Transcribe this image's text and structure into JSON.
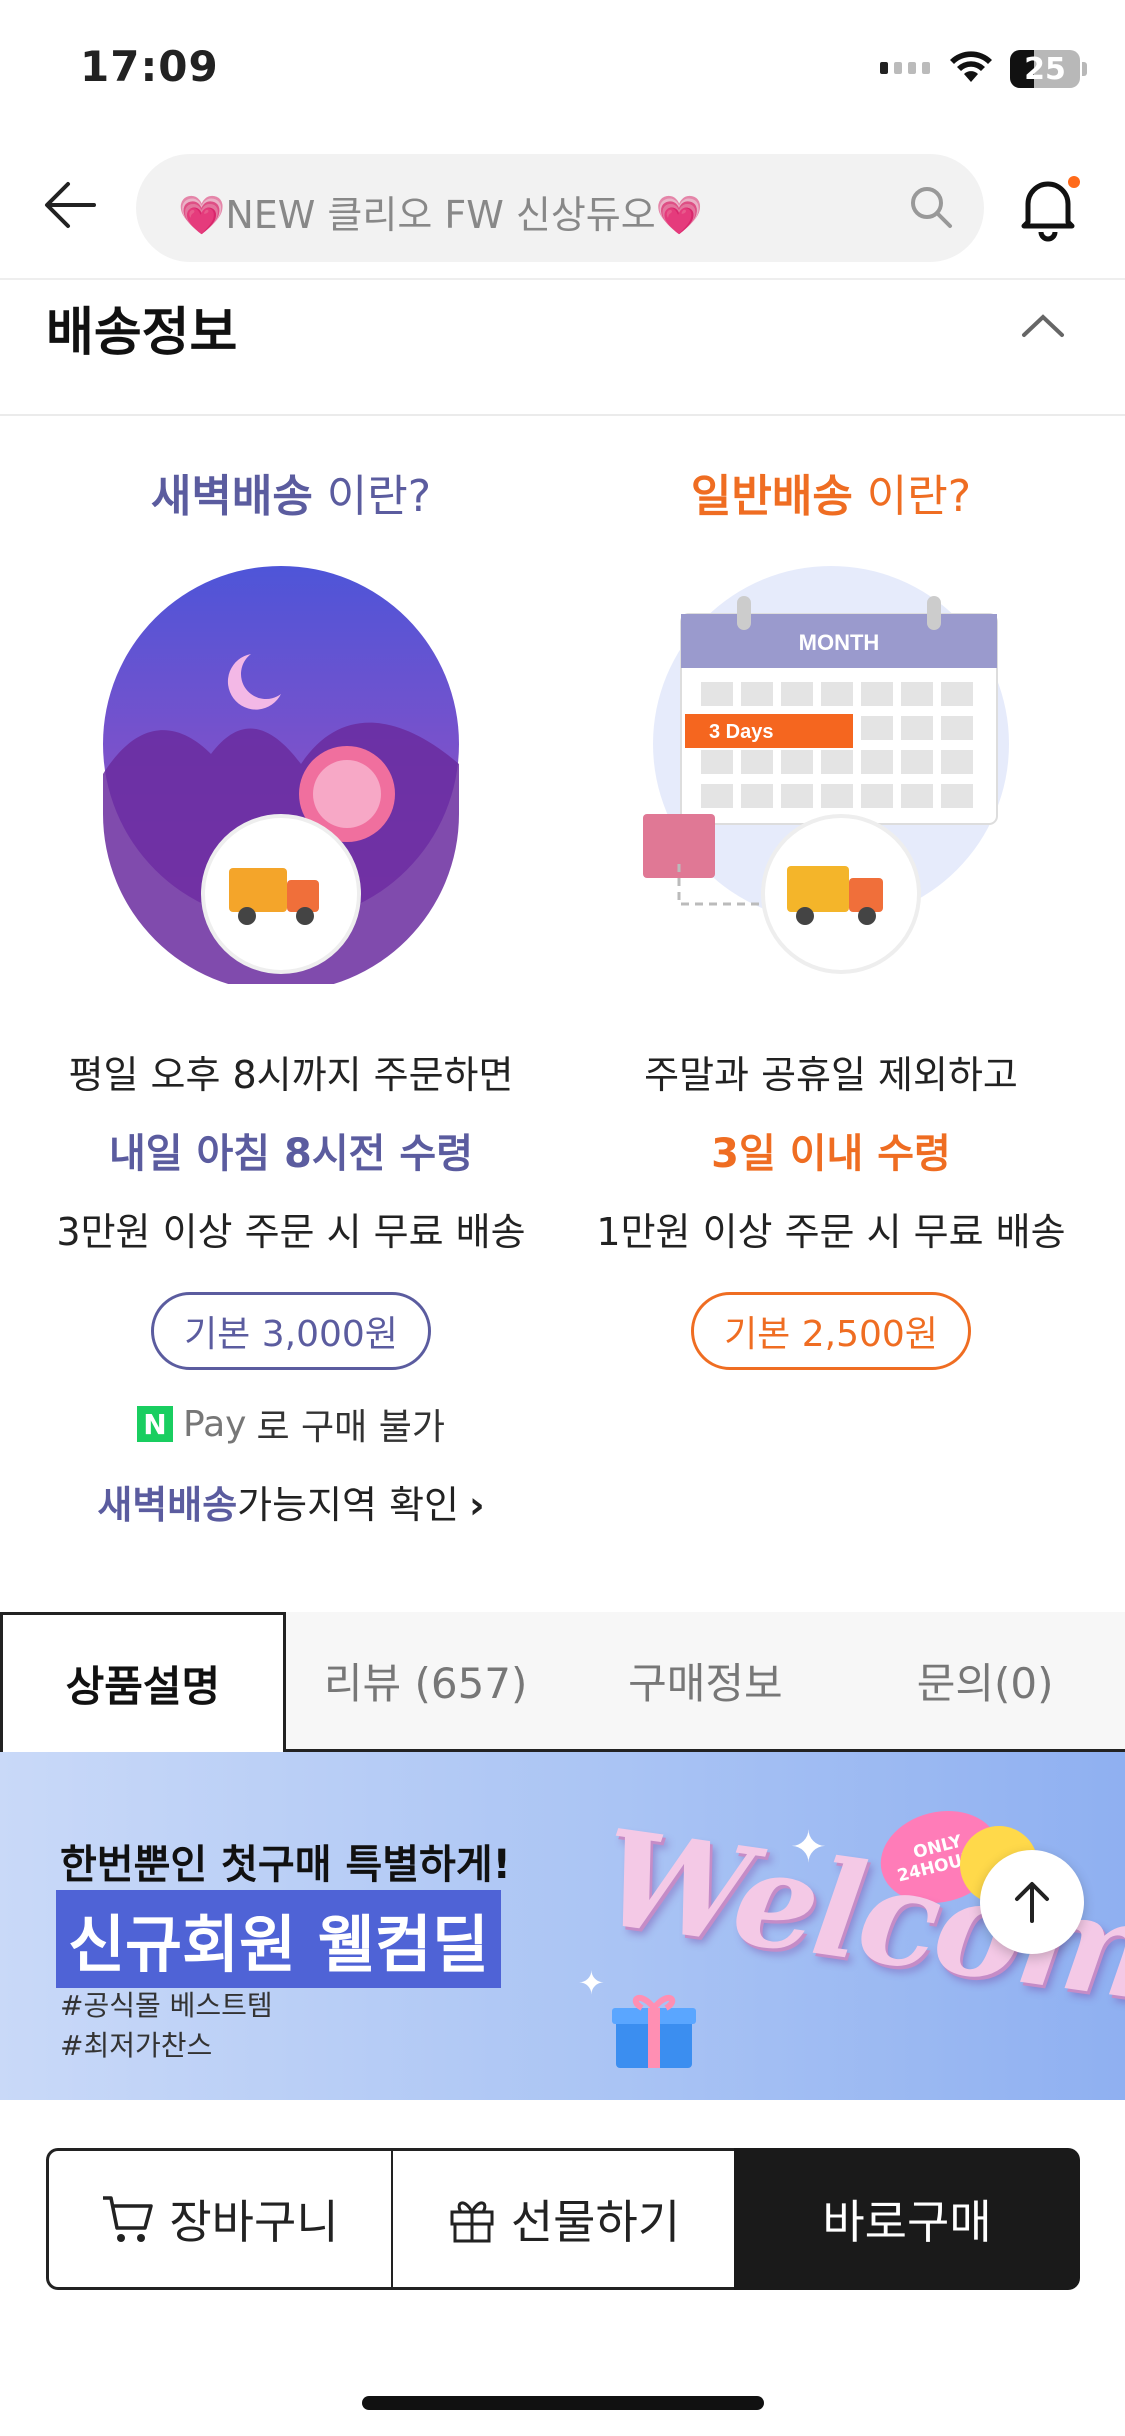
{
  "status_bar": {
    "time": "17:09",
    "battery": "25"
  },
  "header": {
    "search_placeholder": "💗NEW 클리오 FW 신상듀오💗"
  },
  "section": {
    "title": "배송정보"
  },
  "dawn": {
    "title": "새벽배송",
    "title_suffix": " 이란?",
    "line1": "평일 오후 8시까지 주문하면",
    "line2": "내일 아침 8시전 수령",
    "line3": "3만원 이상 주문 시 무료 배송",
    "fee": "기본 3,000원",
    "npay_label": "Pay",
    "npay_text": "로 구매 불가",
    "region_highlight": "새벽배송",
    "region_text": "가능지역 확인",
    "colors": {
      "accent": "#5b5c9f"
    }
  },
  "normal": {
    "title": "일반배송",
    "title_suffix": " 이란?",
    "calendar_month": "MONTH",
    "calendar_tag": "3 Days",
    "line1": "주말과 공휴일 제외하고",
    "line2": "3일 이내 수령",
    "line3": "1만원 이상 주문 시 무료 배송",
    "fee": "기본 2,500원",
    "colors": {
      "accent": "#ef6d22"
    }
  },
  "tabs": [
    "상품설명",
    "리뷰 (657)",
    "구매정보",
    "문의(0)"
  ],
  "banner": {
    "line1": "한번뿐인 첫구매 특별하게!",
    "line2": "신규회원 웰컴딜",
    "tag1": "#공식몰 베스트템",
    "tag2": "#최저가찬스",
    "welcome": "Welcome",
    "badge": "ONLY 24HOURS"
  },
  "bottom": {
    "cart": "장바구니",
    "gift": "선물하기",
    "buy": "바로구매"
  }
}
